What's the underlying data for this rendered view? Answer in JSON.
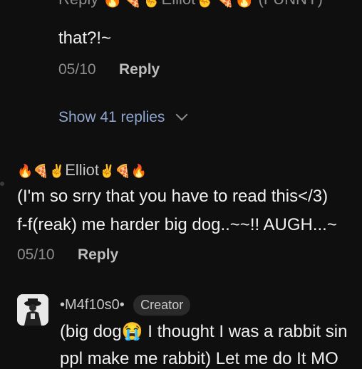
{
  "thread_top": {
    "cut_line": "Reply 🔥🍕✌Elliot✌🍕🔥 (FUNNY)",
    "text": "that?!~",
    "date": "05/10",
    "reply_label": "Reply",
    "show_replies_label": "Show 41 replies"
  },
  "comment_elliot": {
    "name_prefix": "🔥🍕✌",
    "name": "Elliot",
    "name_suffix": "✌🍕🔥",
    "line1": "(I'm so srry that you have to read this</3)",
    "line2": "f-f(reak) me harder big dog..~~!! AUGH...~",
    "date": "05/10",
    "reply_label": "Reply"
  },
  "comment_m4f": {
    "name": "•M4f10s0•",
    "badge": "Creator",
    "line1": "(big dog😭 I thought I was a rabbit sin",
    "line2": "ppl make me rabbit) Let me do It MO",
    "avatar_icon": "profile-photo"
  }
}
